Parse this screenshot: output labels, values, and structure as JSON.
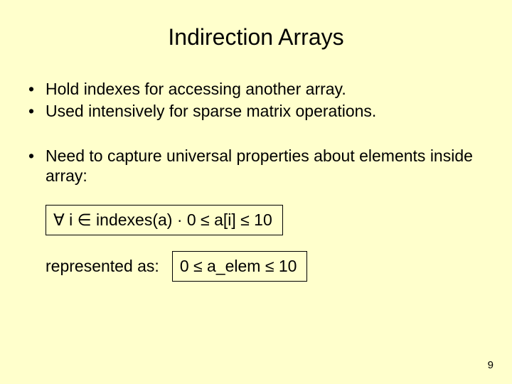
{
  "title": "Indirection Arrays",
  "bullets": {
    "b1": "Hold indexes for accessing another array.",
    "b2": "Used intensively for sparse matrix operations.",
    "b3": "Need to capture universal properties about elements inside array:"
  },
  "formula1": "∀ i ∈ indexes(a) · 0 ≤ a[i] ≤ 10",
  "represented_label": "represented as:",
  "formula2": "0 ≤ a_elem ≤ 10",
  "page_number": "9"
}
